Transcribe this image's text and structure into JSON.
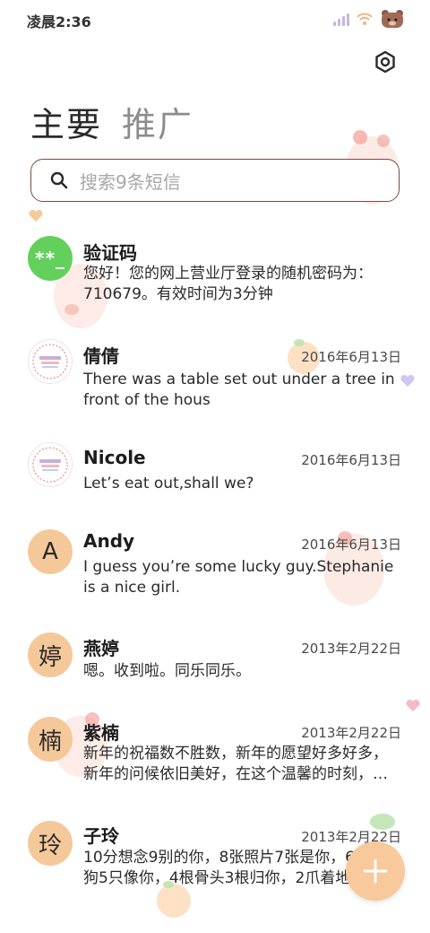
{
  "status_bar": {
    "time": "凌晨2:36"
  },
  "tabs": [
    {
      "label": "主要",
      "active": true
    },
    {
      "label": "推广",
      "active": false
    }
  ],
  "search": {
    "placeholder": "搜索9条短信"
  },
  "conversations": [
    {
      "avatar_text": "**_",
      "avatar_style": "green",
      "name": "验证码",
      "date": "",
      "preview": "您好！您的网上营业厅登录的随机密码为：710679。有效时间为3分钟"
    },
    {
      "avatar_text": "",
      "avatar_style": "badge",
      "name": "倩倩",
      "date": "2016年6月13日",
      "preview": "There was a table set out under a tree in front of the hous"
    },
    {
      "avatar_text": "",
      "avatar_style": "badge",
      "name": "Nicole",
      "date": "2016年6月13日",
      "preview": "Let’s eat out,shall we?"
    },
    {
      "avatar_text": "A",
      "avatar_style": "peach",
      "name": "Andy",
      "date": "2016年6月13日",
      "preview": "I guess you’re some lucky guy.Stephanie is a nice girl."
    },
    {
      "avatar_text": "婷",
      "avatar_style": "peach",
      "name": "燕婷",
      "date": "2013年2月22日",
      "preview": "嗯。收到啦。同乐同乐。"
    },
    {
      "avatar_text": "楠",
      "avatar_style": "peach",
      "name": "紫楠",
      "date": "2013年2月22日",
      "preview": "新年的祝福数不胜数，新年的愿望好多好多，新年的问候依旧美好，在这个温馨的时刻，…"
    },
    {
      "avatar_text": "玲",
      "avatar_style": "peach",
      "name": "子玲",
      "date": "2013年2月22日",
      "preview": "10分想念9别的你，8张照片7张是你，6条小狗5只像你，4根骨头3根归你，2爪着地"
    }
  ],
  "colors": {
    "accent_peach": "#f5c89a",
    "verify_green": "#63d05c",
    "search_border": "#7a4a44"
  }
}
